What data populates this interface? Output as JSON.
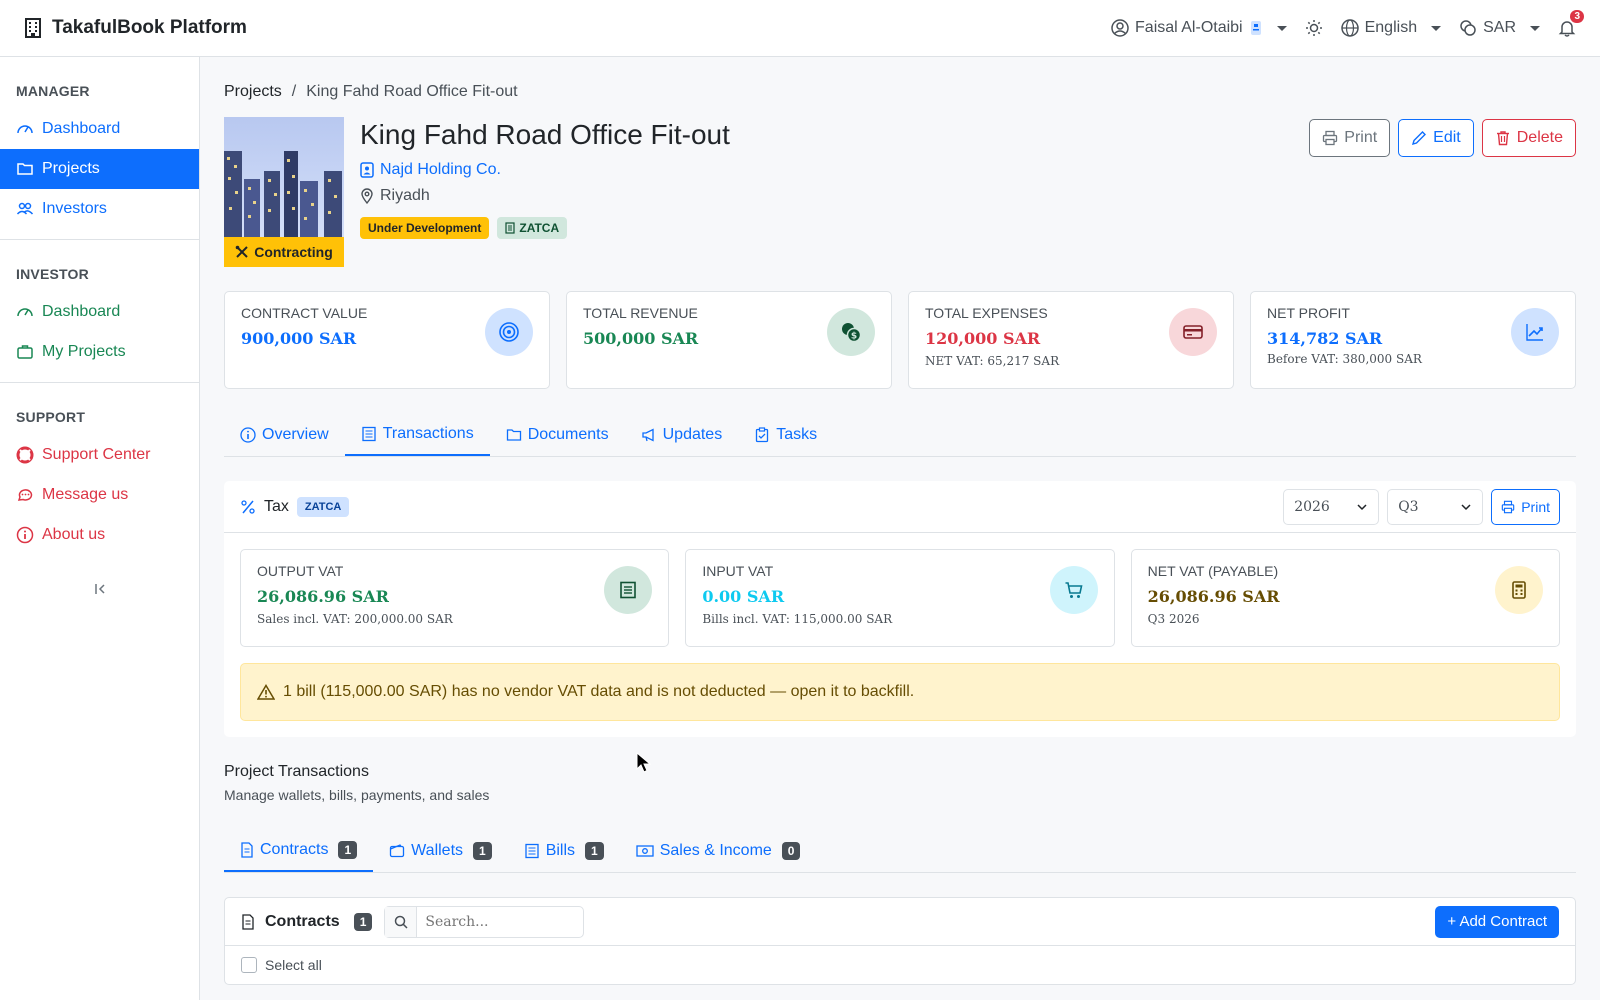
{
  "app": {
    "title": "TakafulBook Platform",
    "user": "Faisal Al-Otaibi",
    "language": "English",
    "currency": "SAR",
    "notifications_count": "3"
  },
  "sidebar": {
    "manager_heading": "MANAGER",
    "manager_items": [
      "Dashboard",
      "Projects",
      "Investors"
    ],
    "investor_heading": "INVESTOR",
    "investor_items": [
      "Dashboard",
      "My Projects"
    ],
    "support_heading": "SUPPORT",
    "support_items": [
      "Support Center",
      "Message us",
      "About us"
    ]
  },
  "breadcrumb": {
    "root": "Projects",
    "separator": "/",
    "current": "King Fahd Road Office Fit-out"
  },
  "project": {
    "title": "King Fahd Road Office Fit-out",
    "client": "Najd Holding Co.",
    "city": "Riyadh",
    "stage": "Contracting",
    "status_badge": "Under Development",
    "zatca_badge": "ZATCA",
    "actions": {
      "print": "Print",
      "edit": "Edit",
      "delete": "Delete"
    }
  },
  "stats": {
    "contract_value": {
      "label": "CONTRACT VALUE",
      "value": "900,000 SAR"
    },
    "total_revenue": {
      "label": "TOTAL REVENUE",
      "value": "500,000 SAR"
    },
    "total_expenses": {
      "label": "TOTAL EXPENSES",
      "value": "120,000 SAR",
      "sub": "NET VAT: 65,217 SAR"
    },
    "net_profit": {
      "label": "NET PROFIT",
      "value": "314,782 SAR",
      "sub": "Before VAT: 380,000 SAR"
    }
  },
  "tabs": [
    "Overview",
    "Transactions",
    "Documents",
    "Updates",
    "Tasks"
  ],
  "tax": {
    "title": "Tax",
    "badge": "ZATCA",
    "year": "2026",
    "quarter": "Q3",
    "print": "Print",
    "output_vat": {
      "label": "OUTPUT VAT",
      "value": "26,086.96 SAR",
      "sub": "Sales incl. VAT: 200,000.00 SAR"
    },
    "input_vat": {
      "label": "INPUT VAT",
      "value": "0.00 SAR",
      "sub": "Bills incl. VAT: 115,000.00 SAR"
    },
    "net_vat": {
      "label": "NET VAT (PAYABLE)",
      "value": "26,086.96 SAR",
      "sub": "Q3 2026"
    },
    "alert": "1 bill (115,000.00 SAR) has no vendor VAT data and is not deducted — open it to backfill."
  },
  "transactions": {
    "title": "Project Transactions",
    "subtitle": "Manage wallets, bills, payments, and sales",
    "tabs": [
      {
        "label": "Contracts",
        "count": "1"
      },
      {
        "label": "Wallets",
        "count": "1"
      },
      {
        "label": "Bills",
        "count": "1"
      },
      {
        "label": "Sales & Income",
        "count": "0"
      }
    ]
  },
  "contracts": {
    "title": "Contracts",
    "count": "1",
    "search_placeholder": "Search...",
    "add_button": "+ Add Contract",
    "select_all": "Select all"
  },
  "colors": {
    "primary": "#0d6efd",
    "success": "#198754",
    "danger": "#dc3545",
    "warning": "#ffc107",
    "info": "#0dcaf0"
  }
}
